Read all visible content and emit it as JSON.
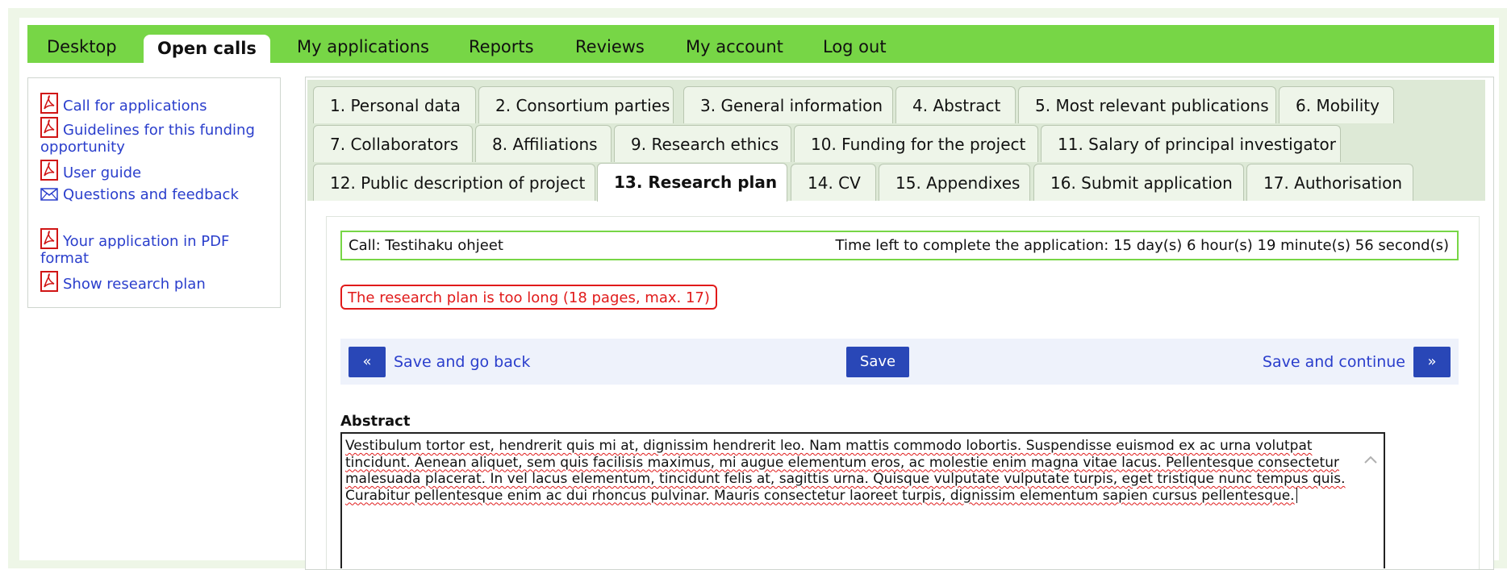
{
  "topnav": {
    "items": [
      "Desktop",
      "Open calls",
      "My applications",
      "Reports",
      "Reviews",
      "My account",
      "Log out"
    ]
  },
  "sidebar": {
    "links": [
      {
        "label": "Call for applications",
        "icon": "pdf-icon"
      },
      {
        "label": "Guidelines for this funding opportunity",
        "icon": "pdf-icon"
      },
      {
        "label": "User guide",
        "icon": "pdf-icon"
      },
      {
        "label": "Questions and feedback",
        "icon": "envelope-icon"
      },
      {
        "label": "Your application in PDF format",
        "icon": "pdf-icon"
      },
      {
        "label": "Show research plan",
        "icon": "pdf-icon"
      }
    ]
  },
  "tabs": [
    "1. Personal data",
    "2. Consortium parties",
    "3. General information",
    "4. Abstract",
    "5. Most relevant publications",
    "6. Mobility",
    "7. Collaborators",
    "8. Affiliations",
    "9. Research ethics",
    "10. Funding for the project",
    "11. Salary of principal investigator",
    "12. Public description of project",
    "13. Research plan",
    "14. CV",
    "15. Appendixes",
    "16. Submit application",
    "17. Authorisation"
  ],
  "active_tab": "13. Research plan",
  "call": {
    "name": "Call: Testihaku ohjeet",
    "time_left": "Time left to complete the application: 15 day(s) 6 hour(s) 19 minute(s) 56 second(s)"
  },
  "error": "The research plan is too long (18 pages, max. 17)",
  "actions": {
    "back_icon": "«",
    "back_label": "Save and go back",
    "save_label": "Save",
    "continue_label": "Save and continue",
    "continue_icon": "»"
  },
  "abstract": {
    "label": "Abstract",
    "text": "Vestibulum tortor est, hendrerit quis mi at, dignissim hendrerit leo. Nam mattis commodo lobortis. Suspendisse euismod ex ac urna volutpat tincidunt. Aenean aliquet, sem quis facilisis maximus, mi augue elementum eros, ac molestie enim magna vitae lacus. Pellentesque consectetur malesuada placerat. In vel lacus elementum, tincidunt felis at, sagittis urna. Quisque vulputate vulputate turpis, eget tristique nunc tempus quis. Curabitur pellentesque enim ac dui rhoncus pulvinar. Mauris consectetur laoreet turpis, dignissim elementum sapien cursus pellentesque."
  },
  "colors": {
    "nav_green": "#77d646",
    "link_blue": "#2a3ecc",
    "button_blue": "#2947b7",
    "error_red": "#e11a1a"
  }
}
